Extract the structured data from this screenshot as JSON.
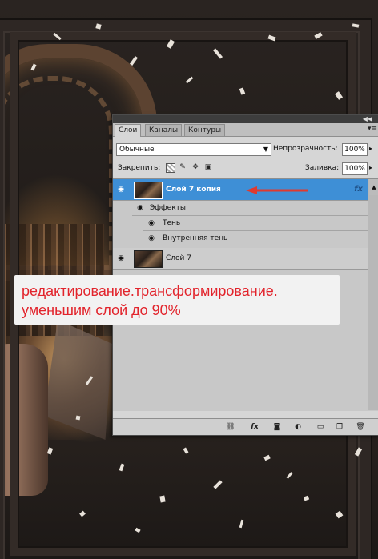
{
  "panel": {
    "tabs": [
      "Слои",
      "Каналы",
      "Контуры"
    ],
    "active_tab": "Слои",
    "blend_mode": "Обычные",
    "opacity_label": "Непрозрачность:",
    "opacity_value": "100%",
    "lock_label": "Закрепить:",
    "fill_label": "Заливка:",
    "fill_value": "100%",
    "layers": [
      {
        "name": "Слой 7 копия",
        "selected": true,
        "has_fx": true,
        "fx_label": "fx"
      },
      {
        "name": "Слой 7",
        "selected": false,
        "has_fx": false
      }
    ],
    "effects_label": "Эффекты",
    "effects": [
      "Тень",
      "Внутренняя тень"
    ]
  },
  "annotation": {
    "line1": "редактирование.трансформирование.",
    "line2": "уменьшим слой до 90%",
    "color": "#e2242c"
  },
  "icons": {
    "eye": "eye-icon",
    "lock_transparent": "lock-transparent-pixels-icon",
    "lock_paint": "lock-image-pixels-icon",
    "lock_move": "lock-position-icon",
    "lock_all": "lock-all-icon",
    "bottom_tools": [
      "link-layers-icon",
      "add-layer-style-icon",
      "add-mask-icon",
      "adjustment-layer-icon",
      "new-group-icon",
      "new-layer-icon",
      "delete-layer-icon"
    ]
  },
  "colors": {
    "selection": "#3e8fd6",
    "arrow": "#e03a2f"
  }
}
